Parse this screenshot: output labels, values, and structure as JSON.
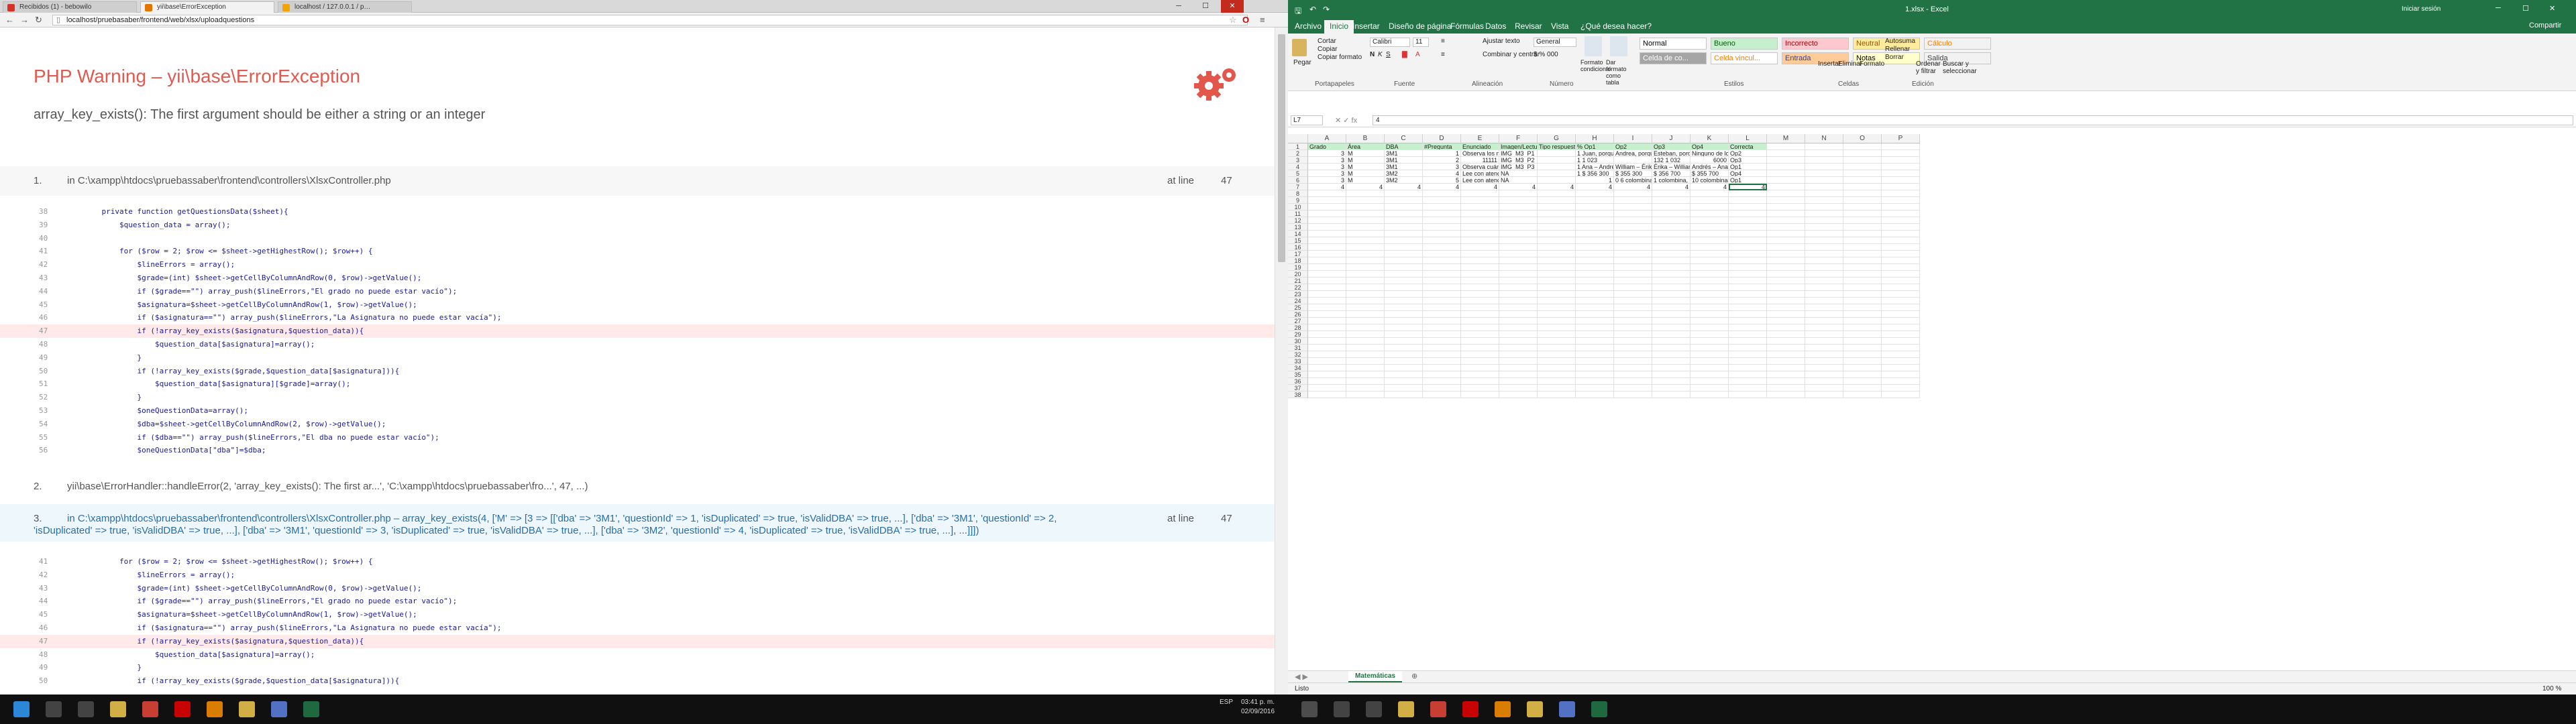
{
  "browser": {
    "tabs": [
      {
        "label": "Recibidos (1) - bebowilo",
        "color": "#d93025"
      },
      {
        "label": "yii\\base\\ErrorException",
        "color": "#e37400",
        "active": true
      },
      {
        "label": "localhost / 127.0.0.1 / p…",
        "color": "#f4a300"
      }
    ],
    "url": "localhost/pruebasaber/frontend/web/xlsx/uploadquestions"
  },
  "error": {
    "title_prefix": "PHP Warning",
    "title_sep": " – ",
    "title_class": "yii\\base\\ErrorException",
    "message": "array_key_exists(): The first argument should be either a string or an integer",
    "frames": [
      {
        "num": "1.",
        "text": "in C:\\xampp\\htdocs\\pruebassaber\\frontend\\controllers\\XlsxController.php",
        "at_line": "at line",
        "line": "47",
        "code": [
          {
            "n": "38",
            "t": "    private function getQuestionsData($sheet){"
          },
          {
            "n": "39",
            "t": "        $question_data = array();"
          },
          {
            "n": "40",
            "t": ""
          },
          {
            "n": "41",
            "t": "        for ($row = 2; $row <= $sheet->getHighestRow(); $row++) {"
          },
          {
            "n": "42",
            "t": "            $lineErrors = array();"
          },
          {
            "n": "43",
            "t": "            $grade=(int) $sheet->getCellByColumnAndRow(0, $row)->getValue();"
          },
          {
            "n": "44",
            "t": "            if ($grade==\"\") array_push($lineErrors,\"El grado no puede estar vacío\");"
          },
          {
            "n": "45",
            "t": "            $asignatura=$sheet->getCellByColumnAndRow(1, $row)->getValue();"
          },
          {
            "n": "46",
            "t": "            if ($asignatura==\"\") array_push($lineErrors,\"La Asignatura no puede estar vacía\");"
          },
          {
            "n": "47",
            "t": "            if (!array_key_exists($asignatura,$question_data)){",
            "hl": true
          },
          {
            "n": "48",
            "t": "                $question_data[$asignatura]=array();"
          },
          {
            "n": "49",
            "t": "            }"
          },
          {
            "n": "50",
            "t": "            if (!array_key_exists($grade,$question_data[$asignatura])){"
          },
          {
            "n": "51",
            "t": "                $question_data[$asignatura][$grade]=array();"
          },
          {
            "n": "52",
            "t": "            }"
          },
          {
            "n": "53",
            "t": "            $oneQuestionData=array();"
          },
          {
            "n": "54",
            "t": "            $dba=$sheet->getCellByColumnAndRow(2, $row)->getValue();"
          },
          {
            "n": "55",
            "t": "            if ($dba==\"\") array_push($lineErrors,\"El dba no puede estar vacío\");"
          },
          {
            "n": "56",
            "t": "            $oneQuestionData[\"dba\"]=$dba;"
          }
        ]
      },
      {
        "num": "2.",
        "text": "yii\\base\\ErrorHandler::handleError(2, 'array_key_exists(): The first ar...', 'C:\\xampp\\htdocs\\pruebassaber\\fro...', 47, ...)"
      },
      {
        "num": "3.",
        "text": "in C:\\xampp\\htdocs\\pruebassaber\\frontend\\controllers\\XlsxController.php – array_key_exists(4, ['M' => [3 => [['dba' => '3M1', 'questionId' => 1, 'isDuplicated' => true, 'isValidDBA' => true, ...], ['dba' => '3M1', 'questionId' => 2,",
        "text2": "'isDuplicated' => true, 'isValidDBA' => true, ...], ['dba' => '3M1', 'questionId' => 3, 'isDuplicated' => true, 'isValidDBA' => true, ...], ['dba' => '3M2', 'questionId' => 4, 'isDuplicated' => true, 'isValidDBA' => true, ...], ...]]])",
        "at_line": "at line",
        "line": "47",
        "code": [
          {
            "n": "41",
            "t": "        for ($row = 2; $row <= $sheet->getHighestRow(); $row++) {"
          },
          {
            "n": "42",
            "t": "            $lineErrors = array();"
          },
          {
            "n": "43",
            "t": "            $grade=(int) $sheet->getCellByColumnAndRow(0, $row)->getValue();"
          },
          {
            "n": "44",
            "t": "            if ($grade==\"\") array_push($lineErrors,\"El grado no puede estar vacío\");"
          },
          {
            "n": "45",
            "t": "            $asignatura=$sheet->getCellByColumnAndRow(1, $row)->getValue();"
          },
          {
            "n": "46",
            "t": "            if ($asignatura==\"\") array_push($lineErrors,\"La Asignatura no puede estar vacía\");"
          },
          {
            "n": "47",
            "t": "            if (!array_key_exists($asignatura,$question_data)){",
            "hl": true
          },
          {
            "n": "48",
            "t": "                $question_data[$asignatura]=array();"
          },
          {
            "n": "49",
            "t": "            }"
          },
          {
            "n": "50",
            "t": "            if (!array_key_exists($grade,$question_data[$asignatura])){"
          }
        ]
      }
    ]
  },
  "excel": {
    "title": "1.xlsx - Excel",
    "signin": "Iniciar sesión",
    "share": "Compartir",
    "ribbon_tabs": [
      "Archivo",
      "Inicio",
      "Insertar",
      "Diseño de página",
      "Fórmulas",
      "Datos",
      "Revisar",
      "Vista",
      "¿Qué desea hacer?"
    ],
    "clipboard": {
      "paste": "Pegar",
      "cut": "Cortar",
      "copy": "Copiar",
      "format_painter": "Copiar formato",
      "group": "Portapapeles"
    },
    "font": {
      "name": "Calibri",
      "size": "11",
      "group": "Fuente"
    },
    "alignment": {
      "wrap": "Ajustar texto",
      "merge": "Combinar y centrar",
      "group": "Alineación"
    },
    "number": {
      "format": "General",
      "group": "Número"
    },
    "styles": {
      "cond": "Formato condicional",
      "table": "Dar formato como tabla",
      "group": "Estilos",
      "items": [
        {
          "label": "Normal",
          "bg": "#ffffff",
          "fg": "#000000"
        },
        {
          "label": "Bueno",
          "bg": "#c6efce",
          "fg": "#006100"
        },
        {
          "label": "Incorrecto",
          "bg": "#ffc7ce",
          "fg": "#9c0006"
        },
        {
          "label": "Neutral",
          "bg": "#ffeb9c",
          "fg": "#9c5700"
        },
        {
          "label": "Cálculo",
          "bg": "#f2f2f2",
          "fg": "#fa7d00"
        },
        {
          "label": "Celda de co...",
          "bg": "#a5a5a5",
          "fg": "#ffffff"
        },
        {
          "label": "Celda vincul...",
          "bg": "#ffffff",
          "fg": "#fa7d00"
        },
        {
          "label": "Entrada",
          "bg": "#ffcc99",
          "fg": "#3f3f76"
        },
        {
          "label": "Notas",
          "bg": "#ffffcc",
          "fg": "#000000"
        },
        {
          "label": "Salida",
          "bg": "#f2f2f2",
          "fg": "#3f3f3f"
        }
      ]
    },
    "cells_group": {
      "insert": "Insertar",
      "delete": "Eliminar",
      "format": "Formato",
      "group": "Celdas"
    },
    "editing": {
      "autosum": "Autosuma",
      "fill": "Rellenar",
      "clear": "Borrar",
      "sort": "Ordenar y filtrar",
      "find": "Buscar y seleccionar",
      "group": "Edición"
    },
    "name_box": "L7",
    "formula_value": "4",
    "columns": [
      "A",
      "B",
      "C",
      "D",
      "E",
      "F",
      "G",
      "H",
      "I",
      "J",
      "K",
      "L",
      "M",
      "N",
      "O",
      "P"
    ],
    "header_row": [
      "Grado",
      "Área",
      "DBA",
      "#Pregunta",
      "Enunciado",
      "Imagen/Lectura",
      "Tipo respuesta 1",
      "% Op1",
      "Op2",
      "Op3",
      "Op4",
      "Correcta"
    ],
    "rows": [
      [
        "3",
        "M",
        "3M1",
        "1",
        "Observa los númer",
        "IMG_M3_P1",
        "",
        "1 Juan, porque 1058",
        "Andrea, porque 36",
        "Esteban, porque 2",
        "Ninguno de los let",
        "Op2"
      ],
      [
        "3",
        "M",
        "3M1",
        "2",
        "11111",
        "IMG_M3_P2",
        "",
        "1 1 023",
        "",
        "132 1 032",
        "6000",
        "Op3"
      ],
      [
        "3",
        "M",
        "3M1",
        "3",
        "Observa cuántos p",
        "IMG_M3_P3",
        "",
        "1 Ana – Andrés – Eril",
        "William – Érika – A",
        "Érika – William – A",
        "Andrés – Ana – Éril",
        "Op1"
      ],
      [
        "3",
        "M",
        "3M2",
        "4",
        "Lee con atención e",
        "NA",
        "",
        "1 $ 356 300",
        "$ 355 300",
        "$ 356 700",
        "$ 355 700",
        "Op4"
      ],
      [
        "3",
        "M",
        "3M2",
        "5",
        "Lee con atención e",
        "NA",
        "",
        "1",
        "0 6 colombinas, 4 ga",
        "1 colombina, 2 ga",
        "10  colombinas, 10",
        "Op1"
      ],
      [
        "4",
        "4",
        "4",
        "4",
        "4",
        "4",
        "4",
        "4",
        "4",
        "4",
        "4",
        "4"
      ]
    ],
    "row_count": 38,
    "sheet_tab": "Matemáticas",
    "status": "Listo",
    "zoom": "100 %"
  },
  "taskbar": {
    "lang": "ESP",
    "time": "03:41 p. m.",
    "date": "02/09/2016"
  }
}
